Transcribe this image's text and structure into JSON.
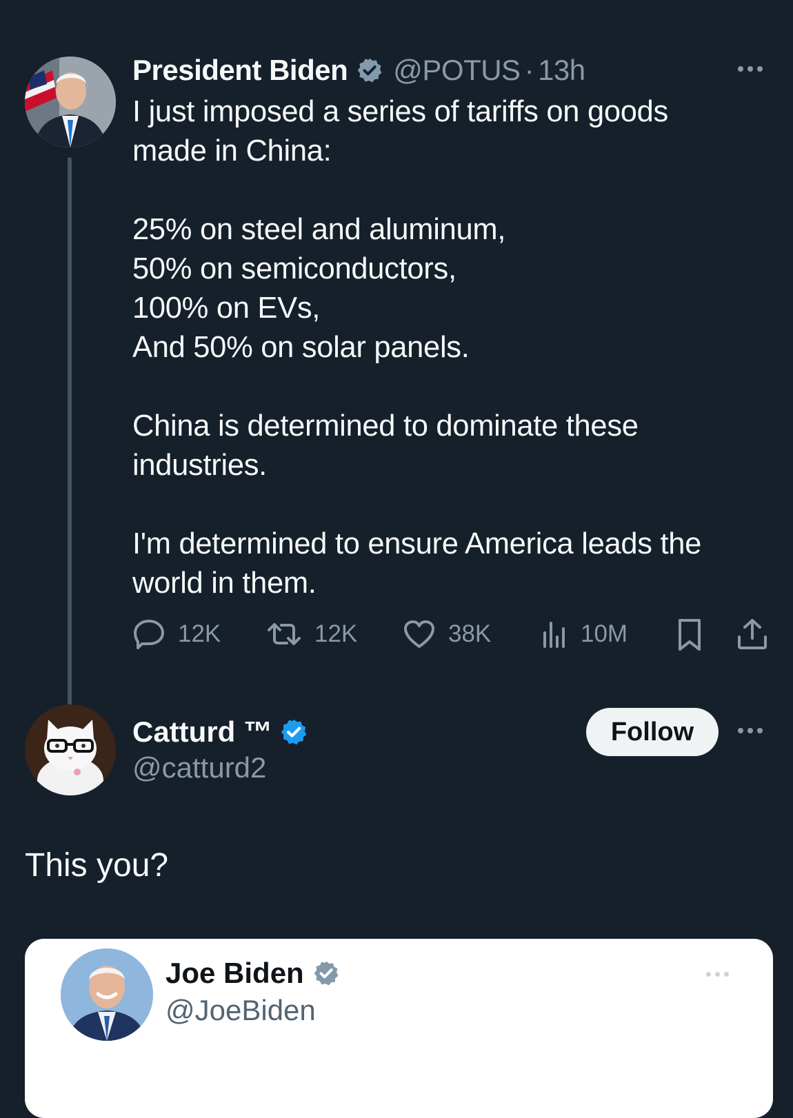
{
  "colors": {
    "background": "#15202b",
    "primary_text": "#f7f9f9",
    "secondary_text": "#8b98a5",
    "thread_line": "#425466",
    "verified_gray": "#829aab",
    "verified_blue": "#1d9bf0",
    "follow_button_bg": "#eff3f4",
    "quote_card_bg": "#ffffff"
  },
  "main_tweet": {
    "author_name": "President Biden",
    "verified_badge": "gray-check",
    "handle": "@POTUS",
    "separator": "·",
    "time": "13h",
    "text": "I just imposed a series of tariffs on goods\nmade in China:\n\n25% on steel and aluminum,\n50% on semiconductors,\n100% on EVs,\nAnd 50% on solar panels.\n\nChina is determined to dominate these\nindustries.\n\nI'm determined to ensure America leads the\nworld in them.",
    "actions": {
      "replies": "12K",
      "reposts": "12K",
      "likes": "38K",
      "views": "10M"
    }
  },
  "reply": {
    "author_name": "Catturd ™",
    "verified_badge": "blue-check",
    "handle": "@catturd2",
    "follow_label": "Follow",
    "text": "This you?"
  },
  "quoted_tweet": {
    "author_name": "Joe Biden",
    "verified_badge": "gray-check",
    "handle": "@JoeBiden"
  }
}
